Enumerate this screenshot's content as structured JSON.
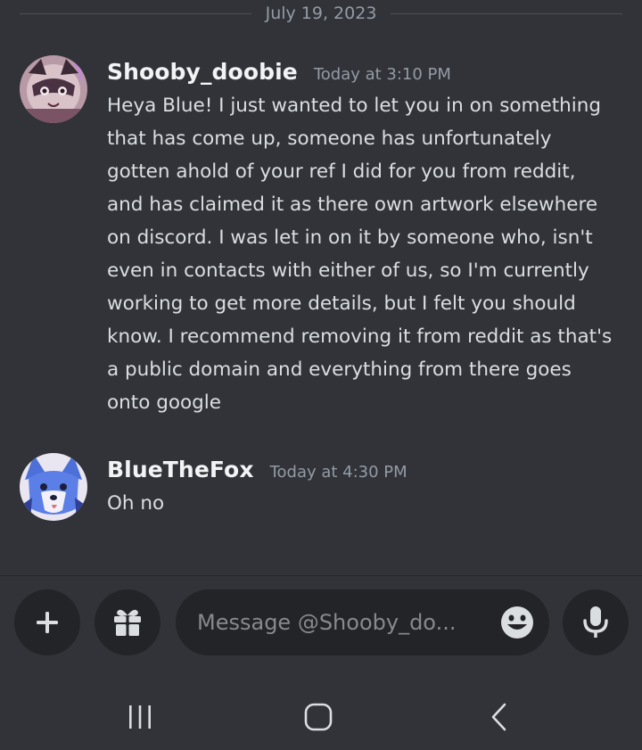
{
  "date_divider": "July 19, 2023",
  "messages": [
    {
      "username": "Shooby_doobie",
      "timestamp": "Today at 3:10 PM",
      "text": "Heya Blue! I just wanted to let you in on something that has come up, someone has unfortunately gotten ahold of your ref I did for you from reddit, and has claimed it as there own artwork elsewhere on discord. I was let in on it by someone who, isn't even in contacts with either of us, so I'm currently working to get more details, but I felt you should know. I recommend removing it from reddit as that's a public domain and everything from there goes onto google",
      "avatar_icon": "raccoon-character-avatar"
    },
    {
      "username": "BlueTheFox",
      "timestamp": "Today at 4:30 PM",
      "text": "Oh no",
      "avatar_icon": "blue-fox-character-avatar"
    }
  ],
  "composer": {
    "placeholder": "Message @Shooby_do...",
    "plus_icon": "plus-icon",
    "gift_icon": "gift-icon",
    "emoji_icon": "emoji-icon",
    "mic_icon": "microphone-icon"
  },
  "nav": {
    "recents_icon": "recents-icon",
    "home_icon": "home-icon",
    "back_icon": "back-icon"
  },
  "colors": {
    "background": "#313338",
    "input_background": "#232428",
    "username": "#f2f3f5",
    "timestamp": "#949ba4",
    "message_text": "#dbdee1"
  }
}
